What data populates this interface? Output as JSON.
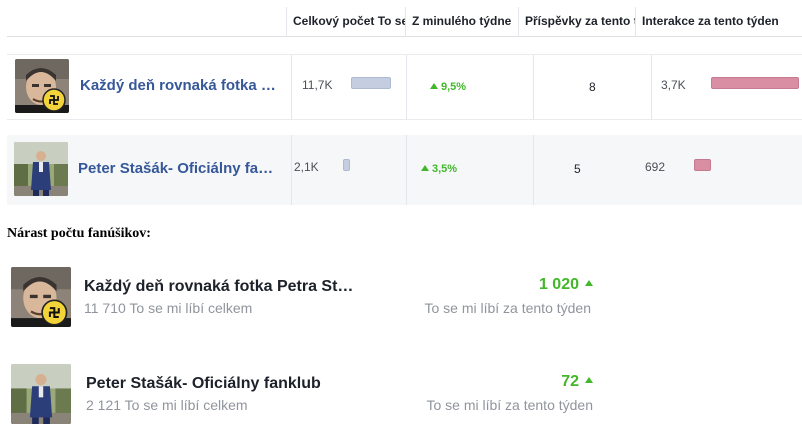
{
  "table": {
    "columns": [
      "",
      "Celkový počet To se mi líbí",
      "Z minulého týdne",
      "Příspěvky za tento týden",
      "Interakce za tento týden"
    ],
    "rows": [
      {
        "page": "Každý deň rovnaká fotka Petra Stašáka",
        "avatar": "petr-stasak-portrait-with-swastika-badge",
        "total_likes": "11,7K",
        "total_likes_fraction": 1.0,
        "change": "9,5%",
        "posts": "8",
        "interactions": "3,7K",
        "interactions_fraction": 1.0
      },
      {
        "page": "Peter Stašák- Oficiálny fanklub",
        "avatar": "man-in-suit-on-street",
        "total_likes": "2,1K",
        "total_likes_fraction": 0.18,
        "change": "3,5%",
        "posts": "5",
        "interactions": "692",
        "interactions_fraction": 0.19
      }
    ]
  },
  "heading": "Nárast počtu fanúšikov:",
  "fans": [
    {
      "name": "Každý deň rovnaká fotka Petra St…",
      "total": "11 710 To se mi líbí celkem",
      "delta": "1 020",
      "week": "To se mi líbí za tento týden"
    },
    {
      "name": "Peter Stašák- Oficiálny fanklub",
      "total": "2 121 To se mi líbí celkem",
      "delta": "72",
      "week": "To se mi líbí za tento týden"
    }
  ],
  "colors": {
    "link": "#365899",
    "positive": "#42b72a",
    "likes_bar": "#c5cde0",
    "interactions_bar": "#d98ea4"
  }
}
